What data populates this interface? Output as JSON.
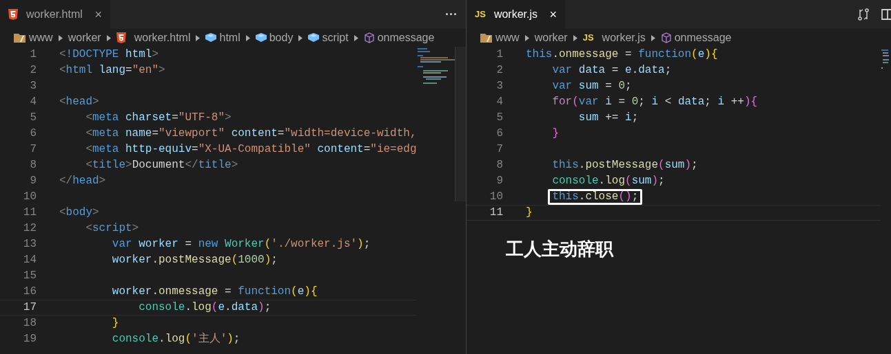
{
  "panes": [
    {
      "tab": {
        "kind": "html",
        "label": "worker.html",
        "close": "×",
        "selected": true,
        "focused": false
      },
      "more": "···",
      "breadcrumbs": [
        {
          "kind": "folder",
          "label": "www"
        },
        {
          "kind": "plain",
          "label": "worker"
        },
        {
          "kind": "html",
          "label": "worker.html"
        },
        {
          "kind": "element",
          "label": "html"
        },
        {
          "kind": "element",
          "label": "body"
        },
        {
          "kind": "element",
          "label": "script"
        },
        {
          "kind": "method",
          "label": "onmessage"
        }
      ],
      "lines": [
        {
          "number": "1",
          "current": false,
          "tokens": [
            {
              "kind": "punct",
              "text": "<"
            },
            {
              "kind": "tag",
              "text": "!DOCTYPE"
            },
            {
              "kind": "attr",
              "text": " html"
            },
            {
              "kind": "punct",
              "text": ">"
            }
          ]
        },
        {
          "number": "2",
          "current": false,
          "tokens": [
            {
              "kind": "punct",
              "text": "<"
            },
            {
              "kind": "tag",
              "text": "html"
            },
            {
              "kind": "attr",
              "text": " lang"
            },
            {
              "kind": "plain",
              "text": "="
            },
            {
              "kind": "string",
              "text": "\"en\""
            },
            {
              "kind": "punct",
              "text": ">"
            }
          ]
        },
        {
          "number": "3",
          "current": false
        },
        {
          "number": "4",
          "current": false,
          "tokens": [
            {
              "kind": "punct",
              "text": "<"
            },
            {
              "kind": "tag",
              "text": "head"
            },
            {
              "kind": "punct",
              "text": ">"
            }
          ],
          "children": [
            {
              "number": "5",
              "current": false,
              "tokens": [
                {
                  "kind": "punct",
                  "text": "<"
                },
                {
                  "kind": "tag",
                  "text": "meta"
                },
                {
                  "kind": "attr",
                  "text": " charset"
                },
                {
                  "kind": "plain",
                  "text": "="
                },
                {
                  "kind": "string",
                  "text": "\"UTF-8\""
                },
                {
                  "kind": "punct",
                  "text": ">"
                }
              ]
            },
            {
              "number": "6",
              "current": false,
              "tokens": [
                {
                  "kind": "punct",
                  "text": "<"
                },
                {
                  "kind": "tag",
                  "text": "meta"
                },
                {
                  "kind": "attr",
                  "text": " name"
                },
                {
                  "kind": "plain",
                  "text": "="
                },
                {
                  "kind": "string",
                  "text": "\"viewport\""
                },
                {
                  "kind": "attr",
                  "text": " content"
                },
                {
                  "kind": "plain",
                  "text": "="
                },
                {
                  "kind": "string",
                  "text": "\"width=device-width,"
                }
              ]
            },
            {
              "number": "7",
              "current": false,
              "tokens": [
                {
                  "kind": "punct",
                  "text": "<"
                },
                {
                  "kind": "tag",
                  "text": "meta"
                },
                {
                  "kind": "attr",
                  "text": " http-equiv"
                },
                {
                  "kind": "plain",
                  "text": "="
                },
                {
                  "kind": "string",
                  "text": "\"X-UA-Compatible\""
                },
                {
                  "kind": "attr",
                  "text": " content"
                },
                {
                  "kind": "plain",
                  "text": "="
                },
                {
                  "kind": "string",
                  "text": "\"ie=edg"
                }
              ]
            },
            {
              "number": "8",
              "current": false,
              "tokens": [
                {
                  "kind": "punct",
                  "text": "<"
                },
                {
                  "kind": "tag",
                  "text": "title"
                },
                {
                  "kind": "punct",
                  "text": ">"
                },
                {
                  "kind": "plain",
                  "text": "Document"
                },
                {
                  "kind": "punct",
                  "text": "</"
                },
                {
                  "kind": "tag",
                  "text": "title"
                },
                {
                  "kind": "punct",
                  "text": ">"
                }
              ]
            }
          ]
        },
        {
          "number": "9",
          "current": false,
          "tokens": [
            {
              "kind": "punct",
              "text": "</"
            },
            {
              "kind": "tag",
              "text": "head"
            },
            {
              "kind": "punct",
              "text": ">"
            }
          ]
        },
        {
          "number": "10",
          "current": false
        },
        {
          "number": "11",
          "current": false,
          "tokens": [
            {
              "kind": "punct",
              "text": "<"
            },
            {
              "kind": "tag",
              "text": "body"
            },
            {
              "kind": "punct",
              "text": ">"
            }
          ],
          "children": [
            {
              "number": "12",
              "current": false,
              "tokens": [
                {
                  "kind": "punct",
                  "text": "<"
                },
                {
                  "kind": "tag",
                  "text": "script"
                },
                {
                  "kind": "punct",
                  "text": ">"
                }
              ],
              "children": [
                {
                  "number": "13",
                  "current": false,
                  "tokens": [
                    {
                      "kind": "keyword",
                      "text": "var"
                    },
                    {
                      "kind": "var",
                      "text": " worker"
                    },
                    {
                      "kind": "plain",
                      "text": " = "
                    },
                    {
                      "kind": "keyword",
                      "text": "new"
                    },
                    {
                      "kind": "class",
                      "text": " Worker"
                    },
                    {
                      "kind": "bracket1",
                      "text": "("
                    },
                    {
                      "kind": "string",
                      "text": "'./worker.js'"
                    },
                    {
                      "kind": "bracket1",
                      "text": ")"
                    },
                    {
                      "kind": "plain",
                      "text": ";"
                    }
                  ]
                },
                {
                  "number": "14",
                  "current": false,
                  "tokens": [
                    {
                      "kind": "var",
                      "text": "worker"
                    },
                    {
                      "kind": "plain",
                      "text": "."
                    },
                    {
                      "kind": "func",
                      "text": "postMessage"
                    },
                    {
                      "kind": "bracket1",
                      "text": "("
                    },
                    {
                      "kind": "number",
                      "text": "1000"
                    },
                    {
                      "kind": "bracket1",
                      "text": ")"
                    },
                    {
                      "kind": "plain",
                      "text": ";"
                    }
                  ]
                },
                {
                  "number": "15",
                  "current": false
                },
                {
                  "number": "16",
                  "current": false,
                  "tokens": [
                    {
                      "kind": "var",
                      "text": "worker"
                    },
                    {
                      "kind": "plain",
                      "text": "."
                    },
                    {
                      "kind": "func",
                      "text": "onmessage"
                    },
                    {
                      "kind": "plain",
                      "text": " = "
                    },
                    {
                      "kind": "keyword",
                      "text": "function"
                    },
                    {
                      "kind": "bracket1",
                      "text": "("
                    },
                    {
                      "kind": "var",
                      "text": "e"
                    },
                    {
                      "kind": "bracket1",
                      "text": ")"
                    },
                    {
                      "kind": "bracket1",
                      "text": "{"
                    }
                  ],
                  "children": [
                    {
                      "number": "17",
                      "current": true,
                      "tokens": [
                        {
                          "kind": "class",
                          "text": "console"
                        },
                        {
                          "kind": "plain",
                          "text": "."
                        },
                        {
                          "kind": "func",
                          "text": "log"
                        },
                        {
                          "kind": "bracket2",
                          "text": "("
                        },
                        {
                          "kind": "var",
                          "text": "e"
                        },
                        {
                          "kind": "plain",
                          "text": "."
                        },
                        {
                          "kind": "var",
                          "text": "data"
                        },
                        {
                          "kind": "bracket2",
                          "text": ")"
                        },
                        {
                          "kind": "plain",
                          "text": ";"
                        }
                      ]
                    }
                  ]
                },
                {
                  "number": "18",
                  "current": false,
                  "tokens": [
                    {
                      "kind": "bracket1",
                      "text": "}"
                    }
                  ]
                },
                {
                  "number": "19",
                  "current": false,
                  "tokens": [
                    {
                      "kind": "class",
                      "text": "console"
                    },
                    {
                      "kind": "plain",
                      "text": "."
                    },
                    {
                      "kind": "func",
                      "text": "log"
                    },
                    {
                      "kind": "bracket1",
                      "text": "("
                    },
                    {
                      "kind": "string",
                      "text": "'主人'"
                    },
                    {
                      "kind": "bracket1",
                      "text": ")"
                    },
                    {
                      "kind": "plain",
                      "text": ";"
                    }
                  ]
                }
              ]
            }
          ]
        }
      ]
    },
    {
      "tab": {
        "kind": "js",
        "icon_text": "JS",
        "label": "worker.js",
        "close": "×",
        "selected": true,
        "focused": true
      },
      "breadcrumbs": [
        {
          "kind": "folder",
          "label": "www"
        },
        {
          "kind": "plain",
          "label": "worker"
        },
        {
          "kind": "js",
          "icon_text": "JS",
          "label": "worker.js"
        },
        {
          "kind": "method",
          "label": "onmessage"
        }
      ],
      "lines": [
        {
          "number": "1",
          "current": false,
          "tokens": [
            {
              "kind": "keyword",
              "text": "this"
            },
            {
              "kind": "plain",
              "text": "."
            },
            {
              "kind": "func",
              "text": "onmessage"
            },
            {
              "kind": "plain",
              "text": " = "
            },
            {
              "kind": "keyword",
              "text": "function"
            },
            {
              "kind": "bracket1",
              "text": "("
            },
            {
              "kind": "var",
              "text": "e"
            },
            {
              "kind": "bracket1",
              "text": ")"
            },
            {
              "kind": "bracket1",
              "text": "{"
            }
          ],
          "children": [
            {
              "number": "2",
              "current": false,
              "tokens": [
                {
                  "kind": "keyword",
                  "text": "var"
                },
                {
                  "kind": "var",
                  "text": " data"
                },
                {
                  "kind": "plain",
                  "text": " = "
                },
                {
                  "kind": "var",
                  "text": "e"
                },
                {
                  "kind": "plain",
                  "text": "."
                },
                {
                  "kind": "var",
                  "text": "data"
                },
                {
                  "kind": "plain",
                  "text": ";"
                }
              ]
            },
            {
              "number": "3",
              "current": false,
              "tokens": [
                {
                  "kind": "keyword",
                  "text": "var"
                },
                {
                  "kind": "var",
                  "text": " sum"
                },
                {
                  "kind": "plain",
                  "text": " = "
                },
                {
                  "kind": "number",
                  "text": "0"
                },
                {
                  "kind": "plain",
                  "text": ";"
                }
              ]
            },
            {
              "number": "4",
              "current": false,
              "tokens": [
                {
                  "kind": "control",
                  "text": "for"
                },
                {
                  "kind": "bracket2",
                  "text": "("
                },
                {
                  "kind": "keyword",
                  "text": "var"
                },
                {
                  "kind": "var",
                  "text": " i"
                },
                {
                  "kind": "plain",
                  "text": " = "
                },
                {
                  "kind": "number",
                  "text": "0"
                },
                {
                  "kind": "plain",
                  "text": "; "
                },
                {
                  "kind": "var",
                  "text": "i"
                },
                {
                  "kind": "plain",
                  "text": " < "
                },
                {
                  "kind": "var",
                  "text": "data"
                },
                {
                  "kind": "plain",
                  "text": "; "
                },
                {
                  "kind": "var",
                  "text": "i"
                },
                {
                  "kind": "plain",
                  "text": " ++"
                },
                {
                  "kind": "bracket2",
                  "text": ")"
                },
                {
                  "kind": "bracket2",
                  "text": "{"
                }
              ],
              "children": [
                {
                  "number": "5",
                  "current": false,
                  "tokens": [
                    {
                      "kind": "var",
                      "text": "sum"
                    },
                    {
                      "kind": "plain",
                      "text": " += "
                    },
                    {
                      "kind": "var",
                      "text": "i"
                    },
                    {
                      "kind": "plain",
                      "text": ";"
                    }
                  ]
                }
              ]
            },
            {
              "number": "6",
              "current": false,
              "tokens": [
                {
                  "kind": "bracket2",
                  "text": "}"
                }
              ]
            },
            {
              "number": "7",
              "current": false
            },
            {
              "number": "8",
              "current": false,
              "tokens": [
                {
                  "kind": "keyword",
                  "text": "this"
                },
                {
                  "kind": "plain",
                  "text": "."
                },
                {
                  "kind": "func",
                  "text": "postMessage"
                },
                {
                  "kind": "bracket2",
                  "text": "("
                },
                {
                  "kind": "var",
                  "text": "sum"
                },
                {
                  "kind": "bracket2",
                  "text": ")"
                },
                {
                  "kind": "plain",
                  "text": ";"
                }
              ]
            },
            {
              "number": "9",
              "current": false,
              "tokens": [
                {
                  "kind": "class",
                  "text": "console"
                },
                {
                  "kind": "plain",
                  "text": "."
                },
                {
                  "kind": "func",
                  "text": "log"
                },
                {
                  "kind": "bracket2",
                  "text": "("
                },
                {
                  "kind": "var",
                  "text": "sum"
                },
                {
                  "kind": "bracket2",
                  "text": ")"
                },
                {
                  "kind": "plain",
                  "text": ";"
                }
              ]
            },
            {
              "number": "10",
              "current": false,
              "boxed": true,
              "tokens": [
                {
                  "kind": "keyword",
                  "text": "this"
                },
                {
                  "kind": "plain",
                  "text": "."
                },
                {
                  "kind": "func",
                  "text": "close"
                },
                {
                  "kind": "bracket2",
                  "text": "("
                },
                {
                  "kind": "bracket2",
                  "text": ")"
                },
                {
                  "kind": "plain",
                  "text": ";"
                }
              ]
            }
          ]
        },
        {
          "number": "11",
          "current": true,
          "tokens": [
            {
              "kind": "bracket1",
              "text": "}"
            }
          ]
        }
      ],
      "caption": "工人主动辞职"
    }
  ]
}
